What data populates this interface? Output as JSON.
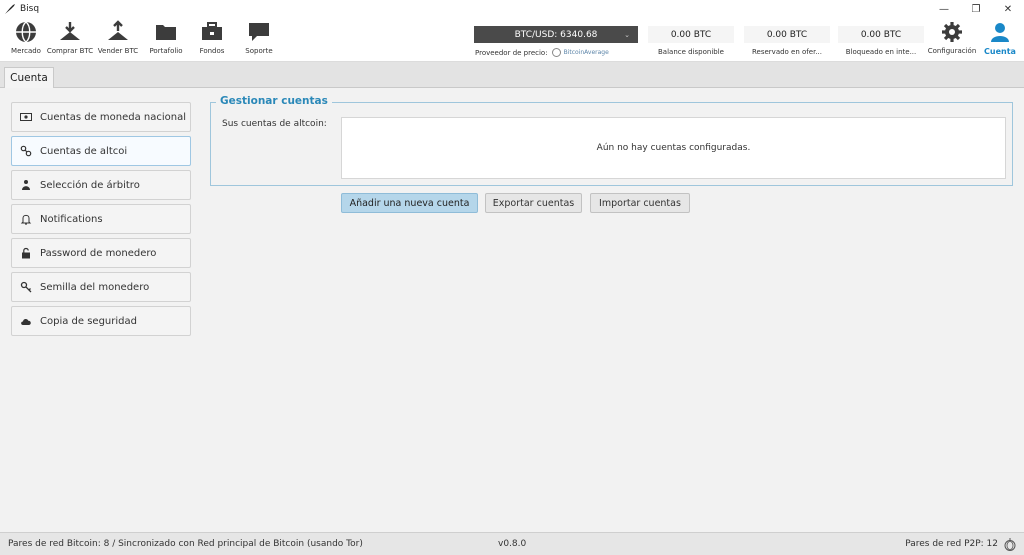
{
  "window": {
    "title": "Bisq"
  },
  "nav": [
    {
      "label": "Mercado",
      "icon": "globe-icon"
    },
    {
      "label": "Comprar BTC",
      "icon": "buy-icon"
    },
    {
      "label": "Vender BTC",
      "icon": "sell-icon"
    },
    {
      "label": "Portafolio",
      "icon": "folder-icon"
    },
    {
      "label": "Fondos",
      "icon": "briefcase-icon"
    },
    {
      "label": "Soporte",
      "icon": "chat-icon"
    }
  ],
  "price": {
    "pair": "BTC/USD: 6340.68",
    "provider_label": "Proveedor de precio:",
    "provider": "BitcoinAverage"
  },
  "balances": [
    {
      "value": "0.00 BTC",
      "label": "Balance disponible"
    },
    {
      "value": "0.00 BTC",
      "label": "Reservado en ofer..."
    },
    {
      "value": "0.00 BTC",
      "label": "Bloqueado en inte..."
    }
  ],
  "right_nav": [
    {
      "label": "Configuración",
      "icon": "gear-icon"
    },
    {
      "label": "Cuenta",
      "icon": "user-icon"
    }
  ],
  "tab": {
    "label": "Cuenta"
  },
  "sidebar": [
    {
      "label": "Cuentas de moneda nacional",
      "icon": "cash-icon"
    },
    {
      "label": "Cuentas de altcoi",
      "icon": "link-icon"
    },
    {
      "label": "Selección de árbitro",
      "icon": "people-icon"
    },
    {
      "label": "Notifications",
      "icon": "bell-icon"
    },
    {
      "label": "Password de monedero",
      "icon": "lock-icon"
    },
    {
      "label": "Semilla del monedero",
      "icon": "key-icon"
    },
    {
      "label": "Copia de seguridad",
      "icon": "cloud-icon"
    }
  ],
  "panel": {
    "title": "Gestionar cuentas",
    "field_label": "Sus cuentas de altcoin:",
    "empty_text": "Aún no hay cuentas configuradas."
  },
  "buttons": {
    "add": "Añadir una nueva cuenta",
    "export": "Exportar cuentas",
    "import": "Importar cuentas"
  },
  "status": {
    "left": "Pares de red Bitcoin: 8 / Sincronizado con Red principal de Bitcoin (usando Tor)",
    "version": "v0.8.0",
    "right": "Pares de red P2P: 12"
  },
  "colors": {
    "accent": "#2a88b8",
    "active_nav": "#1a88c8",
    "primary_button": "#b5d6ea"
  }
}
